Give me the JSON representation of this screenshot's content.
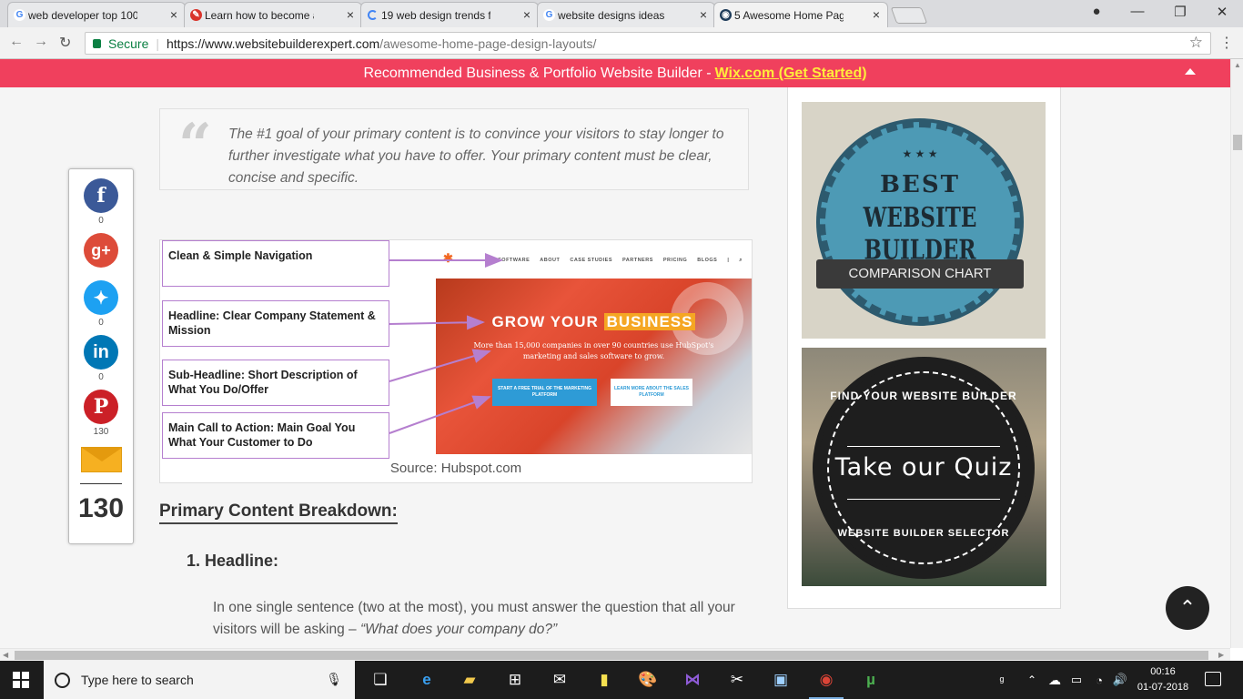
{
  "browser": {
    "tabs": [
      {
        "label": "web developer top 100 s",
        "icon": "google-icon"
      },
      {
        "label": "Learn how to become a w",
        "icon": "site-icon"
      },
      {
        "label": "19 web design trends for",
        "icon": "loading-icon"
      },
      {
        "label": "website designs ideas - G",
        "icon": "google-icon"
      },
      {
        "label": "5 Awesome Home Page D",
        "icon": "site-icon"
      }
    ],
    "secure_label": "Secure",
    "url_host": "https://www.websitebuilderexpert.com",
    "url_path": "/awesome-home-page-design-layouts/"
  },
  "banner": {
    "text": "Recommended Business & Portfolio Website Builder -",
    "link": "Wix.com (Get Started)"
  },
  "quote": {
    "mark": "“",
    "text": "The #1 goal of your primary content is to convince your visitors to stay longer to further investigate what you have to offer.  Your primary content must be clear, concise and specific."
  },
  "figure": {
    "callouts": [
      "Clean & Simple Navigation",
      "Headline: Clear Company Statement & Mission",
      "Sub-Headline: Short Description of What You Do/Offer",
      "Main Call to Action: Main Goal You What Your Customer to Do"
    ],
    "nav_items": [
      "SOFTWARE",
      "ABOUT",
      "CASE STUDIES",
      "PARTNERS",
      "PRICING",
      "BLOGS",
      "|",
      "⌕"
    ],
    "headline": "GROW YOUR",
    "headline_highlight": "BUSINESS",
    "subheadline": "More than 15,000 companies in over 90 countries use HubSpot's marketing and sales software to grow.",
    "cta_primary": "START A FREE TRIAL OF THE MARKETING PLATFORM",
    "cta_secondary": "LEARN MORE ABOUT THE SALES PLATFORM",
    "caption": "Source: Hubspot.com"
  },
  "article": {
    "section_title": "Primary Content Breakdown:",
    "list_heading": "1. Headline:",
    "paragraph_start": "In one single sentence (two at the most), you must answer the question that all your visitors will be asking – ",
    "paragraph_quote": "“What does your company do?”"
  },
  "share": {
    "facebook": "0",
    "googleplus": "",
    "twitter": "0",
    "linkedin": "0",
    "pinterest": "130",
    "total": "130",
    "colors": {
      "facebook": "#3b5998",
      "googleplus": "#dd4b39",
      "twitter": "#1da1f2",
      "linkedin": "#0077b5",
      "pinterest": "#cb2027"
    }
  },
  "sidebar": {
    "badge_best": "BEST",
    "badge_title": "WEBSITE BUILDER",
    "badge_ribbon": "COMPARISON CHART",
    "quiz_top": "FIND YOUR WEBSITE BUILDER",
    "quiz_main": "Take our Quiz",
    "quiz_bottom": "WEBSITE BUILDER SELECTOR"
  },
  "taskbar": {
    "search_placeholder": "Type here to search",
    "time": "00:16",
    "date": "01-07-2018"
  }
}
